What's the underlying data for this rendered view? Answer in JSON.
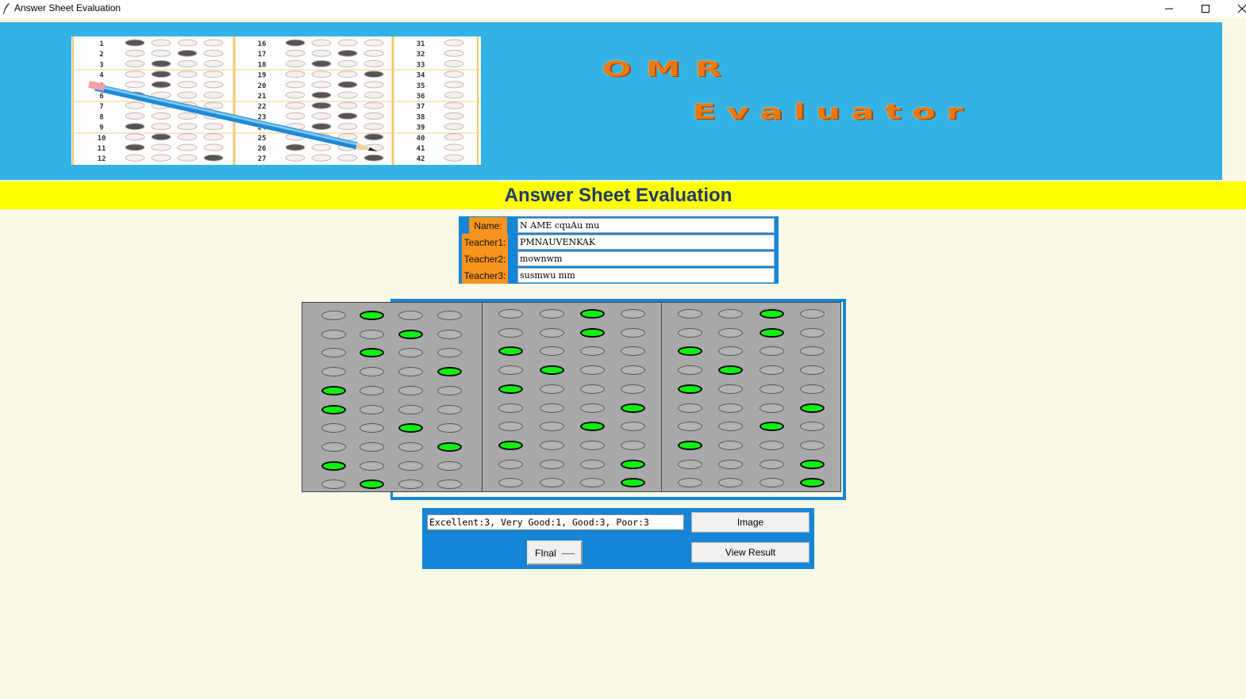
{
  "window": {
    "title": "Answer Sheet Evaluation"
  },
  "banner": {
    "logo_line1": "OMR",
    "logo_line2": "Evaluator",
    "sheet_numbers": [
      [
        "1",
        "2",
        "3",
        "4",
        "5",
        "6",
        "7",
        "8",
        "9",
        "10",
        "11",
        "12"
      ],
      [
        "16",
        "17",
        "18",
        "19",
        "20",
        "21",
        "22",
        "23",
        "24",
        "25",
        "26",
        "27"
      ],
      [
        "31",
        "32",
        "33",
        "34",
        "35",
        "36",
        "37",
        "38",
        "39",
        "40",
        "41",
        "42"
      ]
    ]
  },
  "heading": "Answer Sheet Evaluation",
  "form": {
    "fields": [
      {
        "label": "Name:",
        "value": "N AME cquAu mu"
      },
      {
        "label": "Teacher1:",
        "value": "PMNAUVENKAK"
      },
      {
        "label": "Teacher2:",
        "value": "mownwm"
      },
      {
        "label": "Teacher3:",
        "value": "susmwu mm"
      }
    ]
  },
  "omr": {
    "colors": {
      "marked": "#11ee11",
      "empty": "#b3b3b5",
      "sheet": "#a9a9ab"
    },
    "grids": [
      {
        "answers": [
          2,
          3,
          2,
          4,
          1,
          1,
          3,
          4,
          1,
          2
        ]
      },
      {
        "answers": [
          3,
          3,
          1,
          2,
          1,
          4,
          3,
          1,
          4,
          4
        ]
      },
      {
        "answers": [
          3,
          3,
          1,
          2,
          1,
          4,
          3,
          1,
          4,
          4
        ]
      }
    ],
    "options_per_question": 4
  },
  "controls": {
    "summary": "Excellent:3, Very Good:1, Good:3, Poor:3",
    "image_button": "Image",
    "view_result_button": "View Result",
    "mode_select": "FInal"
  }
}
